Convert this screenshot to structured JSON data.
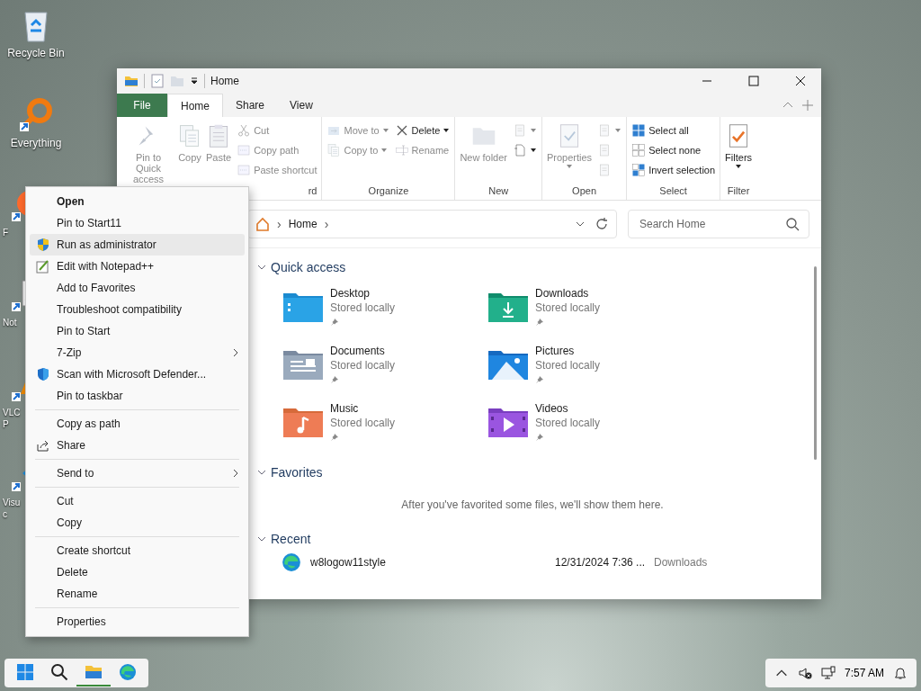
{
  "desktop_icons": [
    {
      "kind": "recycle-bin",
      "label": [
        "Recycle Bin"
      ]
    },
    {
      "kind": "search-app",
      "label": [
        "Everything"
      ]
    },
    {
      "kind": "browser",
      "label": [
        "F"
      ]
    },
    {
      "kind": "notepad",
      "label": [
        "Not"
      ]
    },
    {
      "kind": "media-player",
      "label": [
        "VLC",
        "P"
      ]
    },
    {
      "kind": "code-editor",
      "label": [
        "Visu",
        "c"
      ]
    }
  ],
  "window": {
    "title": "Home",
    "tabs": [
      {
        "label": "File",
        "kind": "file",
        "selected": false
      },
      {
        "label": "Home",
        "kind": "tab",
        "selected": true
      },
      {
        "label": "Share",
        "kind": "tab",
        "selected": false
      },
      {
        "label": "View",
        "kind": "tab",
        "selected": false
      }
    ],
    "ribbon": [
      {
        "label": "rd",
        "columns": [
          {
            "kind": "large",
            "items": [
              {
                "label": "Pin to Quick access",
                "disabled": true,
                "dropdown": false
              },
              {
                "label": "Copy",
                "disabled": true,
                "dropdown": false
              },
              {
                "label": "Paste",
                "disabled": true,
                "dropdown": false
              }
            ]
          },
          {
            "kind": "small",
            "items": [
              {
                "label": "Cut",
                "disabled": true,
                "dropdown": false
              },
              {
                "label": "Copy path",
                "disabled": true,
                "dropdown": false
              },
              {
                "label": "Paste shortcut",
                "disabled": true,
                "dropdown": false
              }
            ]
          }
        ]
      },
      {
        "label": "Organize",
        "columns": [
          {
            "kind": "small",
            "items": [
              {
                "label": "Move to",
                "disabled": true,
                "dropdown": true
              },
              {
                "label": "Copy to",
                "disabled": true,
                "dropdown": true
              }
            ]
          },
          {
            "kind": "small",
            "items": [
              {
                "label": "Delete",
                "disabled": false,
                "dropdown": true
              },
              {
                "label": "Rename",
                "disabled": true,
                "dropdown": false
              }
            ]
          }
        ]
      },
      {
        "label": "New",
        "columns": [
          {
            "kind": "large",
            "items": [
              {
                "label": "New folder",
                "disabled": true,
                "dropdown": false
              }
            ]
          },
          {
            "kind": "small",
            "items": [
              {
                "disabled": true,
                "dropdown": true
              },
              {
                "disabled": false,
                "dropdown": true
              }
            ]
          }
        ]
      },
      {
        "label": "Open",
        "columns": [
          {
            "kind": "large",
            "items": [
              {
                "label": "Properties",
                "disabled": true,
                "dropdown": true
              }
            ]
          },
          {
            "kind": "small",
            "items": [
              {
                "disabled": true,
                "dropdown": true
              },
              {
                "disabled": true,
                "dropdown": false
              },
              {
                "disabled": true,
                "dropdown": false
              }
            ]
          }
        ]
      },
      {
        "label": "Select",
        "columns": [
          {
            "kind": "small",
            "items": [
              {
                "label": "Select all",
                "disabled": false,
                "dropdown": false
              },
              {
                "label": "Select none",
                "disabled": false,
                "dropdown": false
              },
              {
                "label": "Invert selection",
                "disabled": false,
                "dropdown": false
              }
            ]
          }
        ]
      },
      {
        "label": "Filter",
        "columns": [
          {
            "kind": "large",
            "items": [
              {
                "label": "Filters",
                "disabled": false,
                "dropdown": true
              }
            ]
          }
        ]
      }
    ],
    "address": {
      "items": [
        {
          "kind": "chevron",
          "text": "›"
        },
        {
          "kind": "crumb",
          "text": "Home"
        },
        {
          "kind": "chevron",
          "text": "›"
        }
      ]
    },
    "search": {
      "placeholder": "Search Home"
    },
    "sections": [
      {
        "title": "Quick access",
        "kind": "grid",
        "items": [
          {
            "kind": "desktop",
            "name": "Desktop",
            "status": "Stored locally",
            "pinned": true
          },
          {
            "kind": "downloads",
            "name": "Downloads",
            "status": "Stored locally",
            "pinned": true
          },
          {
            "kind": "documents",
            "name": "Documents",
            "status": "Stored locally",
            "pinned": true
          },
          {
            "kind": "pictures",
            "name": "Pictures",
            "status": "Stored locally",
            "pinned": true
          },
          {
            "kind": "music",
            "name": "Music",
            "status": "Stored locally",
            "pinned": true
          },
          {
            "kind": "videos",
            "name": "Videos",
            "status": "Stored locally",
            "pinned": true
          }
        ]
      },
      {
        "title": "Favorites",
        "kind": "message",
        "message": "After you've favorited some files, we'll show them here."
      },
      {
        "title": "Recent",
        "kind": "list",
        "rows": [
          {
            "name": "w8logow11style",
            "date": "12/31/2024 7:36 ...",
            "location": "Downloads"
          }
        ]
      }
    ]
  },
  "context_menu": {
    "groups": [
      [
        {
          "label": "Open",
          "bold": true,
          "highlighted": false,
          "submenu": false
        },
        {
          "label": "Pin to Start11",
          "bold": false,
          "highlighted": false,
          "submenu": false
        },
        {
          "label": "Run as administrator",
          "kind": "shield",
          "bold": false,
          "highlighted": true,
          "submenu": false
        },
        {
          "label": "Edit with Notepad++",
          "kind": "notepad",
          "bold": false,
          "highlighted": false,
          "submenu": false
        },
        {
          "label": "Add to Favorites",
          "bold": false,
          "highlighted": false,
          "submenu": false
        },
        {
          "label": "Troubleshoot compatibility",
          "bold": false,
          "highlighted": false,
          "submenu": false
        },
        {
          "label": "Pin to Start",
          "bold": false,
          "highlighted": false,
          "submenu": false
        },
        {
          "label": "7-Zip",
          "bold": false,
          "highlighted": false,
          "submenu": true
        },
        {
          "label": "Scan with Microsoft Defender...",
          "kind": "defender",
          "bold": false,
          "highlighted": false,
          "submenu": false
        },
        {
          "label": "Pin to taskbar",
          "bold": false,
          "highlighted": false,
          "submenu": false
        }
      ],
      [
        {
          "label": "Copy as path",
          "bold": false,
          "highlighted": false,
          "submenu": false
        },
        {
          "label": "Share",
          "kind": "share",
          "bold": false,
          "highlighted": false,
          "submenu": false
        }
      ],
      [
        {
          "label": "Send to",
          "bold": false,
          "highlighted": false,
          "submenu": true
        }
      ],
      [
        {
          "label": "Cut",
          "bold": false,
          "highlighted": false,
          "submenu": false
        },
        {
          "label": "Copy",
          "bold": false,
          "highlighted": false,
          "submenu": false
        }
      ],
      [
        {
          "label": "Create shortcut",
          "bold": false,
          "highlighted": false,
          "submenu": false
        },
        {
          "label": "Delete",
          "bold": false,
          "highlighted": false,
          "submenu": false
        },
        {
          "label": "Rename",
          "bold": false,
          "highlighted": false,
          "submenu": false
        }
      ],
      [
        {
          "label": "Properties",
          "bold": false,
          "highlighted": false,
          "submenu": false
        }
      ]
    ]
  },
  "taskbar": {
    "apps": [
      {
        "kind": "start",
        "active": false
      },
      {
        "kind": "search",
        "active": false
      },
      {
        "kind": "explorer",
        "active": true
      },
      {
        "kind": "browser",
        "active": false
      }
    ],
    "tray": {
      "time": "7:57 AM"
    }
  }
}
